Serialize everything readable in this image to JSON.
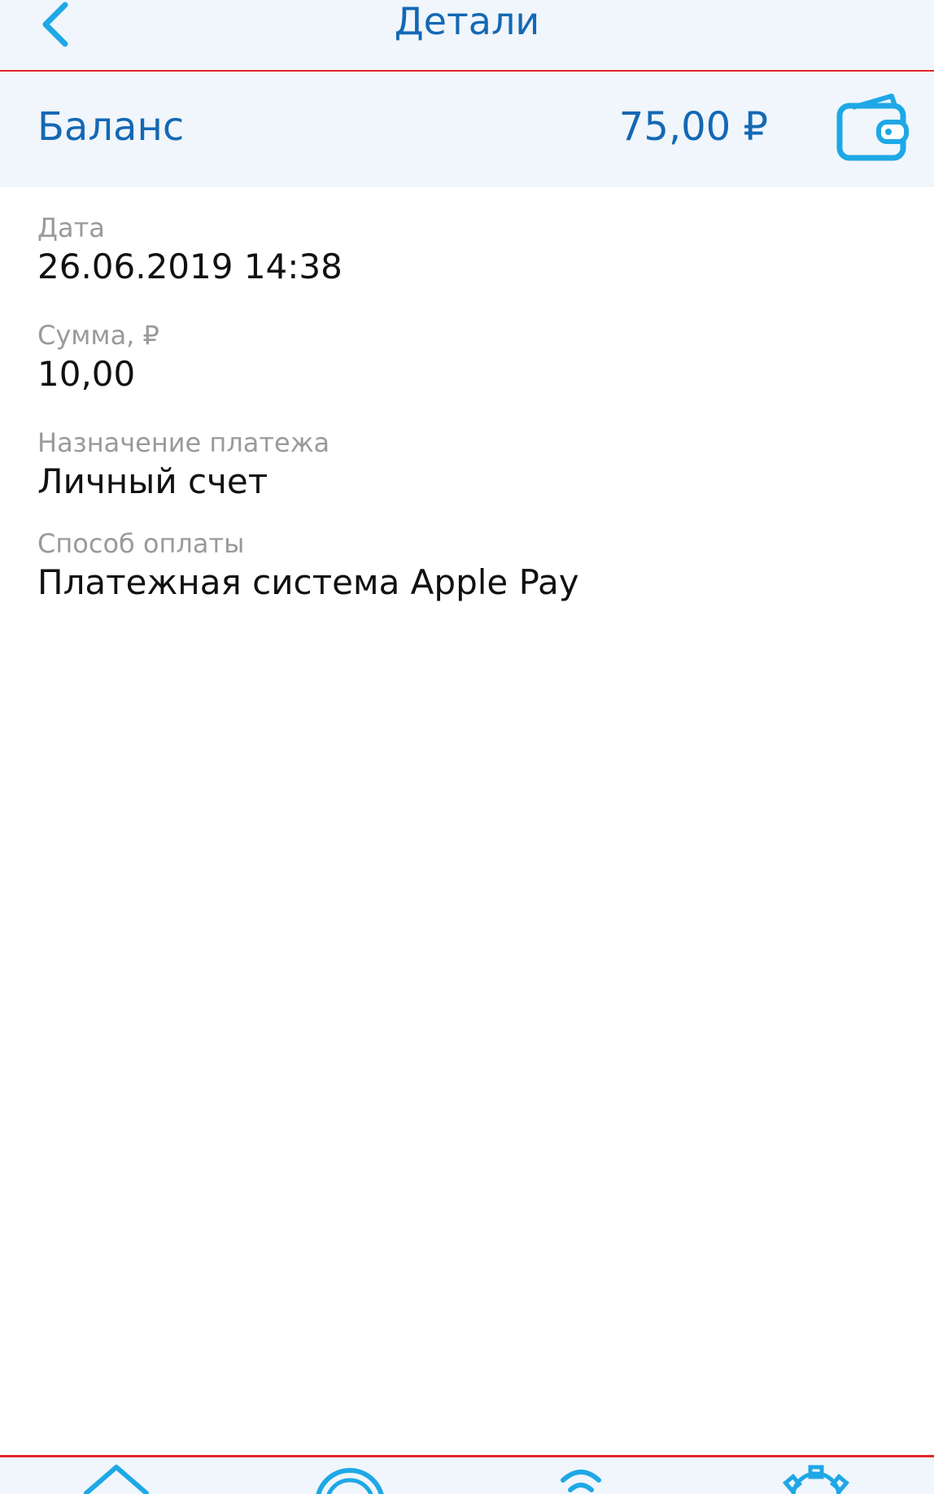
{
  "header": {
    "title": "Детали",
    "back_icon": "chevron-left-icon"
  },
  "balance": {
    "label": "Баланс",
    "amount": "75,00 ₽",
    "wallet_icon": "wallet-icon"
  },
  "details": {
    "date_label": "Дата",
    "date_value": "26.06.2019 14:38",
    "sum_label": "Сумма, ₽",
    "sum_value": "10,00",
    "purpose_label": "Назначение платежа",
    "purpose_value": "Личный счет",
    "method_label": "Способ оплаты",
    "method_value": "Платежная система Apple Pay"
  },
  "tabbar": {
    "items": [
      {
        "icon": "home-icon"
      },
      {
        "icon": "circle-icon"
      },
      {
        "icon": "wifi-icon"
      },
      {
        "icon": "gear-icon"
      }
    ]
  },
  "colors": {
    "accent": "#1468b4",
    "icon_blue": "#1ea8e6",
    "divider_red": "#e2242b",
    "bar_background": "#f0f6fb"
  }
}
